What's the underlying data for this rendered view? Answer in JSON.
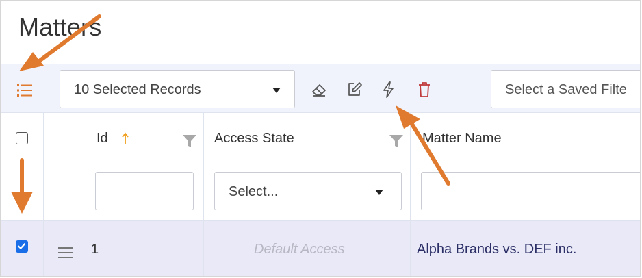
{
  "page": {
    "title": "Matters"
  },
  "toolbar": {
    "records_select": {
      "value": "10 Selected Records"
    },
    "icons": [
      "list-icon",
      "eraser-icon",
      "edit-icon",
      "lightning-icon",
      "trash-icon"
    ],
    "saved_filter": {
      "placeholder": "Select a Saved Filte"
    }
  },
  "grid": {
    "columns": [
      {
        "label": "Id",
        "sort": "ascending"
      },
      {
        "label": "Access State"
      },
      {
        "label": "Matter Name"
      }
    ],
    "filters": {
      "id_value": "",
      "access_state_select": "Select...",
      "matter_name_value": ""
    },
    "rows": [
      {
        "checked": true,
        "id": "1",
        "access_state": "Default Access",
        "matter_name": "Alpha Brands vs. DEF inc."
      }
    ]
  },
  "colors": {
    "annotation_arrow": "#e07a2e",
    "toolbar_bg": "#f0f3fb",
    "selected_row_bg": "#e9e9f8",
    "checkbox_checked": "#1a6ee8",
    "matter_name_text": "#2b2f66",
    "trash_icon": "#c0393b",
    "sort_arrow": "#f0a020"
  }
}
